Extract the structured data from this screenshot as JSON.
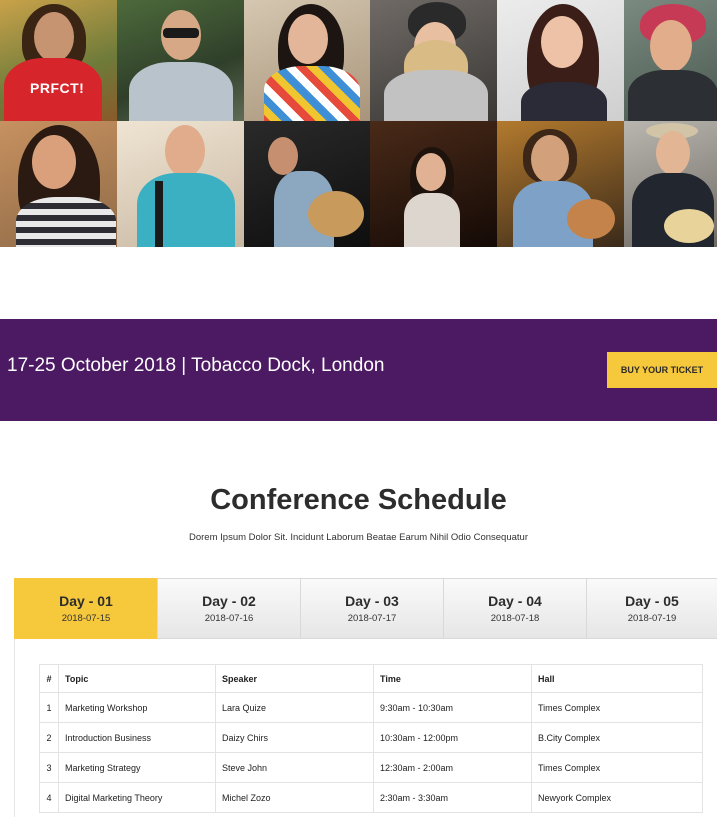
{
  "banner": {
    "text": "17-25 October 2018 | Tobacco Dock, London",
    "button_label": "BUY YOUR TICKET"
  },
  "gallery": {
    "shirt_text": "PRFCT!"
  },
  "schedule": {
    "title": "Conference Schedule",
    "subtitle": "Dorem Ipsum Dolor Sit. Incidunt Laborum Beatae Earum Nihil Odio Consequatur",
    "tabs": [
      {
        "label": "Day - 01",
        "date": "2018-07-15"
      },
      {
        "label": "Day - 02",
        "date": "2018-07-16"
      },
      {
        "label": "Day - 03",
        "date": "2018-07-17"
      },
      {
        "label": "Day - 04",
        "date": "2018-07-18"
      },
      {
        "label": "Day - 05",
        "date": "2018-07-19"
      }
    ],
    "headers": {
      "num": "#",
      "topic": "Topic",
      "speaker": "Speaker",
      "time": "Time",
      "hall": "Hall"
    },
    "rows": [
      {
        "num": "1",
        "topic": "Marketing Workshop",
        "speaker": "Lara Quize",
        "time": "9:30am - 10:30am",
        "hall": "Times Complex"
      },
      {
        "num": "2",
        "topic": "Introduction Business",
        "speaker": "Daizy Chirs",
        "time": "10:30am - 12:00pm",
        "hall": "B.City Complex"
      },
      {
        "num": "3",
        "topic": "Marketing Strategy",
        "speaker": "Steve John",
        "time": "12:30am - 2:00am",
        "hall": "Times Complex"
      },
      {
        "num": "4",
        "topic": "Digital Marketing Theory",
        "speaker": "Michel Zozo",
        "time": "2:30am - 3:30am",
        "hall": "Newyork Complex"
      }
    ]
  },
  "colors": {
    "accent": "#f6c83b",
    "banner_bg": "#4c1a63"
  }
}
